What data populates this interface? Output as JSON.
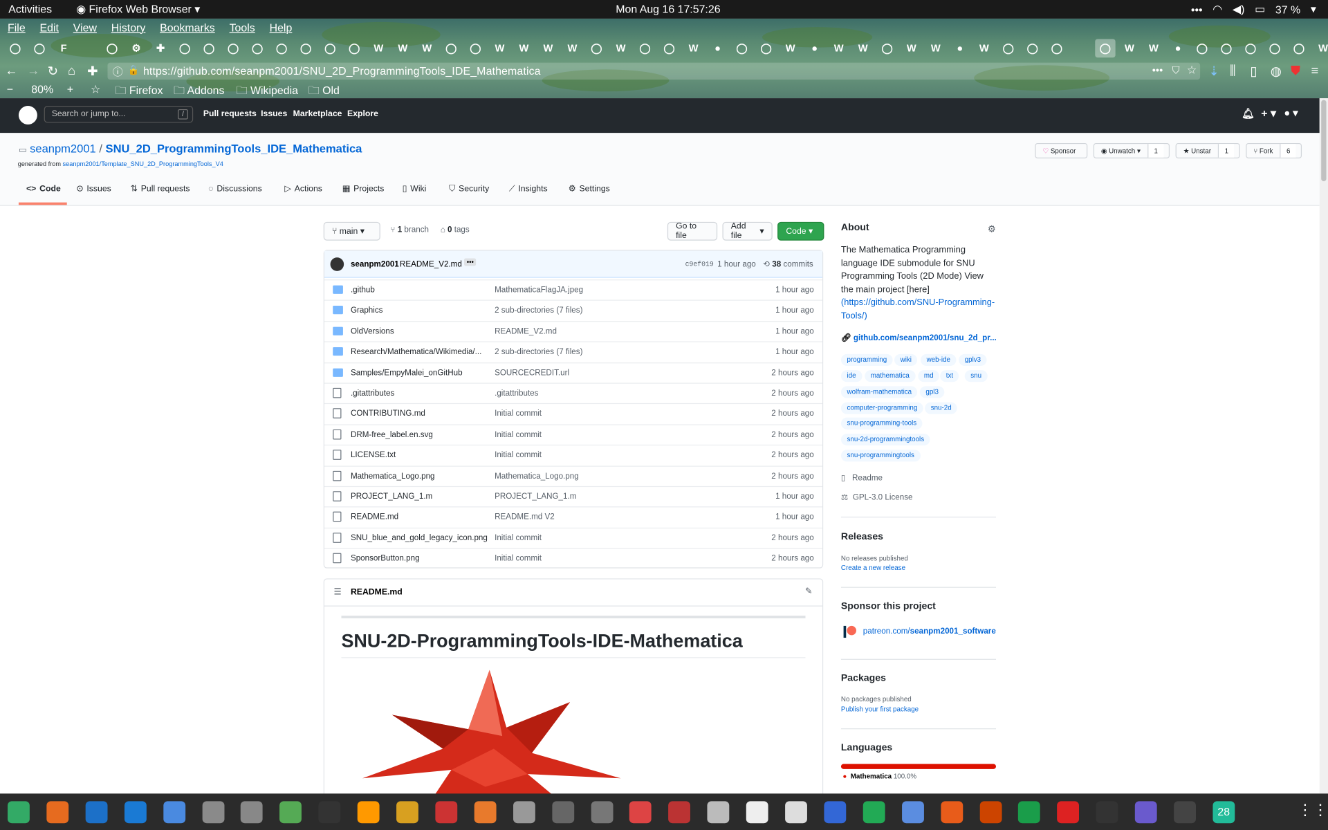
{
  "system": {
    "activities": "Activities",
    "app_menu": "Firefox Web Browser",
    "clock": "Mon Aug 16  17:57:26",
    "battery": "37 %",
    "dock_badge": "28"
  },
  "firefox": {
    "menu": [
      "File",
      "Edit",
      "View",
      "History",
      "Bookmarks",
      "Tools",
      "Help"
    ],
    "url": "https://github.com/seanpm2001/SNU_2D_ProgrammingTools_IDE_Mathematica",
    "zoom": "80%",
    "bookmarks": [
      "Firefox",
      "Addons",
      "Wikipedia",
      "Old"
    ]
  },
  "github": {
    "search_placeholder": "Search or jump to...",
    "search_key": "/",
    "nav": [
      "Pull requests",
      "Issues",
      "Marketplace",
      "Explore"
    ],
    "owner": "seanpm2001",
    "sep": "/",
    "repo": "SNU_2D_ProgrammingTools_IDE_Mathematica",
    "generated_prefix": "generated from ",
    "generated_link": "seanpm2001/Template_SNU_2D_ProgrammingTools_V4",
    "sponsor": "Sponsor",
    "unwatch": "Unwatch",
    "watch_count": "1",
    "unstar": "Unstar",
    "star_count": "1",
    "fork": "Fork",
    "fork_count": "6",
    "tabs": [
      "Code",
      "Issues",
      "Pull requests",
      "Discussions",
      "Actions",
      "Projects",
      "Wiki",
      "Security",
      "Insights",
      "Settings"
    ],
    "branch": "main",
    "branch_count": "1",
    "branch_label": "branch",
    "tag_count": "0",
    "tag_label": "tags",
    "goto": "Go to file",
    "addfile": "Add file",
    "code": "Code",
    "commit": {
      "author": "seanpm2001",
      "message": "README_V2.md",
      "hash": "c9ef019",
      "time": "1 hour ago",
      "count": "38",
      "count_label": "commits"
    },
    "files": [
      {
        "name": ".github",
        "msg": "MathematicaFlagJA.jpeg",
        "age": "1 hour ago",
        "type": "dir"
      },
      {
        "name": "Graphics",
        "msg": "2 sub-directories (7 files)",
        "age": "1 hour ago",
        "type": "dir"
      },
      {
        "name": "OldVersions",
        "msg": "README_V2.md",
        "age": "1 hour ago",
        "type": "dir"
      },
      {
        "name": "Research/Mathematica/Wikimedia/...",
        "msg": "2 sub-directories (7 files)",
        "age": "1 hour ago",
        "type": "dir"
      },
      {
        "name": "Samples/EmpyMalei_onGitHub",
        "msg": "SOURCECREDIT.url",
        "age": "2 hours ago",
        "type": "dir"
      },
      {
        "name": ".gitattributes",
        "msg": ".gitattributes",
        "age": "2 hours ago",
        "type": "file"
      },
      {
        "name": "CONTRIBUTING.md",
        "msg": "Initial commit",
        "age": "2 hours ago",
        "type": "file"
      },
      {
        "name": "DRM-free_label.en.svg",
        "msg": "Initial commit",
        "age": "2 hours ago",
        "type": "file"
      },
      {
        "name": "LICENSE.txt",
        "msg": "Initial commit",
        "age": "2 hours ago",
        "type": "file"
      },
      {
        "name": "Mathematica_Logo.png",
        "msg": "Mathematica_Logo.png",
        "age": "2 hours ago",
        "type": "file"
      },
      {
        "name": "PROJECT_LANG_1.m",
        "msg": "PROJECT_LANG_1.m",
        "age": "1 hour ago",
        "type": "file"
      },
      {
        "name": "README.md",
        "msg": "README.md V2",
        "age": "1 hour ago",
        "type": "file"
      },
      {
        "name": "SNU_blue_and_gold_legacy_icon.png",
        "msg": "Initial commit",
        "age": "2 hours ago",
        "type": "file"
      },
      {
        "name": "SponsorButton.png",
        "msg": "Initial commit",
        "age": "2 hours ago",
        "type": "file"
      }
    ],
    "readme_file": "README.md",
    "readme_title": "SNU-2D-ProgrammingTools-IDE-Mathematica",
    "about": {
      "title": "About",
      "desc": "The Mathematica Programming language IDE submodule for SNU Programming Tools (2D Mode) View the main project [here]",
      "desc_link": "(https://github.com/SNU-Programming-Tools/)",
      "homepage": "github.com/seanpm2001/snu_2d_pr...",
      "topics": [
        "programming",
        "wiki",
        "web-ide",
        "gplv3",
        "ide",
        "mathematica",
        "md",
        "txt",
        "snu",
        "wolfram-mathematica",
        "gpl3",
        "computer-programming",
        "snu-2d",
        "snu-programming-tools",
        "snu-2d-programmingtools",
        "snu-programmingtools"
      ],
      "readme": "Readme",
      "license": "GPL-3.0 License"
    },
    "releases": {
      "title": "Releases",
      "none": "No releases published",
      "create": "Create a new release"
    },
    "sponsor_section": {
      "title": "Sponsor this project",
      "link_prefix": "patreon.com/",
      "link_bold": "seanpm2001_software"
    },
    "packages": {
      "title": "Packages",
      "none": "No packages published",
      "publish": "Publish your first package"
    },
    "languages": {
      "title": "Languages",
      "name": "Mathematica",
      "pct": "100.0%",
      "color": "#dd1100"
    }
  }
}
